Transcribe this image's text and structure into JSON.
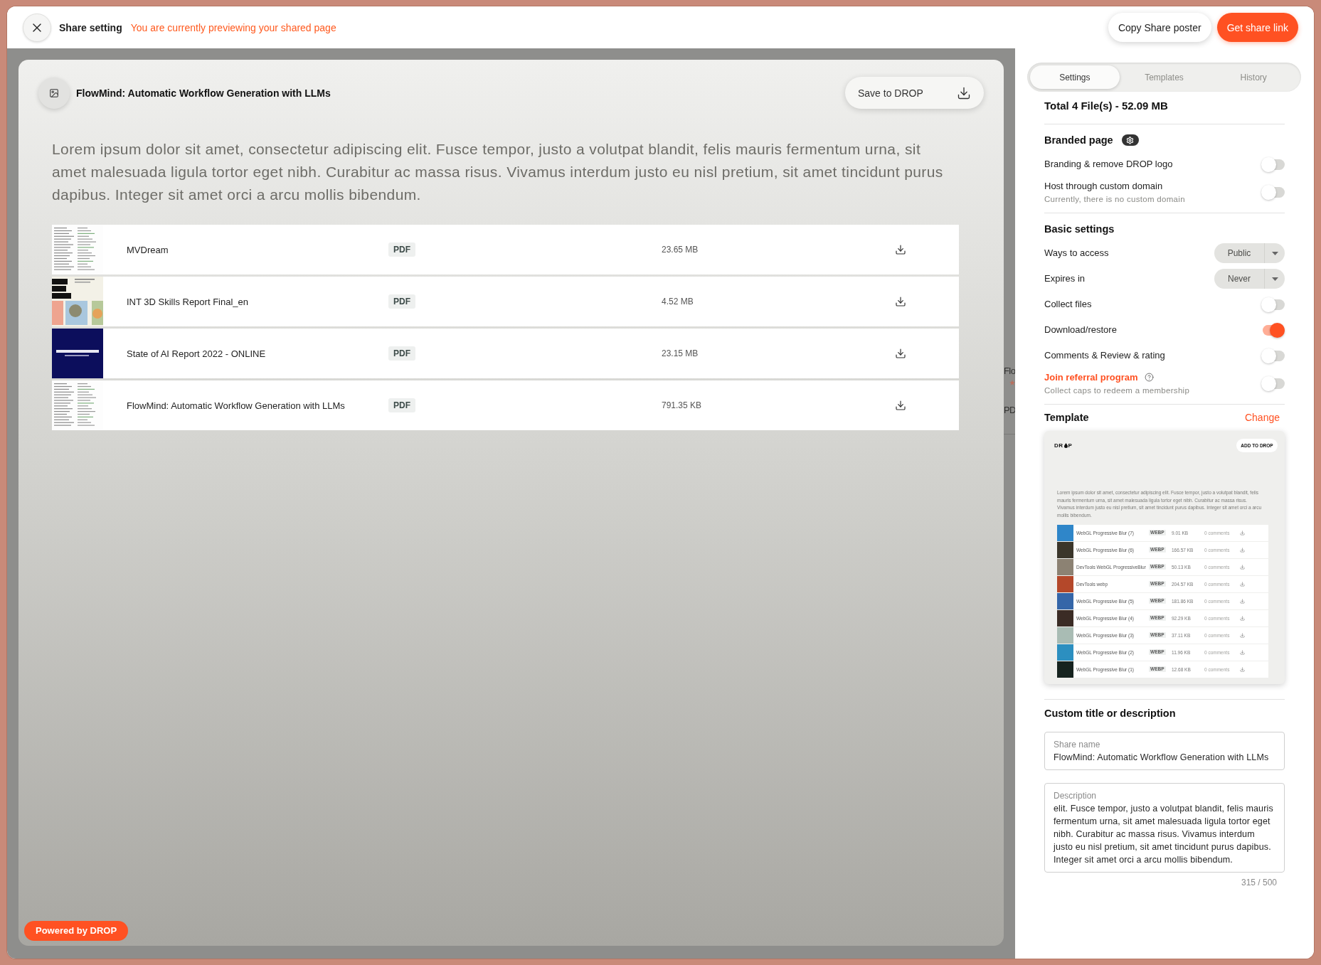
{
  "topbar": {
    "title": "Share setting",
    "notice": "You are currently previewing your shared page",
    "buttons": [
      {
        "label": "Copy Share poster",
        "kind": "secondary"
      },
      {
        "label": "Get share link",
        "kind": "primary"
      }
    ]
  },
  "preview": {
    "title": "FlowMind: Automatic Workflow Generation with LLMs",
    "save_button": "Save to DROP",
    "description": "Lorem ipsum dolor sit amet, consectetur adipiscing elit. Fusce tempor, justo a volutpat blandit, felis mauris fermentum urna, sit amet malesuada ligula tortor eget nibh. Curabitur ac massa risus. Vivamus interdum justo eu nisl pretium, sit amet tincidunt purus dapibus. Integer sit amet orci a arcu mollis bibendum.",
    "files": [
      {
        "name": "MVDream",
        "type": "PDF",
        "size": "23.65 MB",
        "thumbnail": {
          "kind": "text-page"
        }
      },
      {
        "name": "INT 3D Skills Report Final_en",
        "type": "PDF",
        "size": "4.52 MB",
        "thumbnail": {
          "kind": "light-cover"
        }
      },
      {
        "name": "State of AI Report 2022 - ONLINE",
        "type": "PDF",
        "size": "23.15 MB",
        "thumbnail": {
          "kind": "dark-cover"
        }
      },
      {
        "name": "FlowMind: Automatic Workflow Generation with LLMs",
        "type": "PDF",
        "size": "791.35 KB",
        "thumbnail": {
          "kind": "text-page"
        }
      }
    ],
    "powered_by": "Powered by DROP"
  },
  "background_fragments": [
    "Flo",
    "PD"
  ],
  "panel": {
    "tabs": [
      {
        "label": "Settings",
        "selected": true
      },
      {
        "label": "Templates",
        "selected": false
      },
      {
        "label": "History",
        "selected": false
      }
    ],
    "total": "Total 4 File(s) - 52.09 MB",
    "sections": [
      {
        "kind": "branded",
        "title": "Branded page",
        "items": [
          {
            "kind": "toggle",
            "label": "Branding & remove DROP logo",
            "on": false
          },
          {
            "kind": "toggle",
            "label": "Host through custom domain",
            "note": "Currently, there is no custom domain",
            "on": false
          }
        ]
      },
      {
        "kind": "plain",
        "title": "Basic settings",
        "items": [
          {
            "kind": "select",
            "label": "Ways to access",
            "value": "Public"
          },
          {
            "kind": "select",
            "label": "Expires in",
            "value": "Never"
          },
          {
            "kind": "toggle",
            "label": "Collect files",
            "on": false
          },
          {
            "kind": "toggle",
            "label": "Download/restore",
            "on": true
          },
          {
            "kind": "toggle",
            "label": "Comments & Review & rating",
            "on": false
          },
          {
            "kind": "referral",
            "label": "Join referral program",
            "note": "Collect caps to redeem a membership",
            "on": false
          }
        ]
      }
    ],
    "template": {
      "title": "Template",
      "action": "Change",
      "preview": {
        "logo": [
          "DR",
          "P"
        ],
        "button": "ADD TO DROP",
        "description": "Lorem ipsum dolor sit amet, consectetur adipiscing elit. Fusce tempor, justo a volutpat blandit, felis mauris fermentum urna, sit amet malesuada ligula tortor eget nibh. Curabitur ac massa risus. Vivamus interdum justo eu nisl pretium, sit amet tincidunt purus dapibus. Integer sit amet orci a arcu mollis bibendum.",
        "files": [
          {
            "name": "WebGL Progressive Blur (7)",
            "type": "WEBP",
            "size": "9.01 KB",
            "comments": "0 comments"
          },
          {
            "name": "WebGL Progressive Blur (6)",
            "type": "WEBP",
            "size": "166.57 KB",
            "comments": "0 comments"
          },
          {
            "name": "DevTools WebGL ProgressiveBlur",
            "type": "WEBP",
            "size": "50.13 KB",
            "comments": "0 comments"
          },
          {
            "name": "DevTools webp",
            "type": "WEBP",
            "size": "204.57 KB",
            "comments": "0 comments"
          },
          {
            "name": "WebGL Progressive Blur (5)",
            "type": "WEBP",
            "size": "181.86 KB",
            "comments": "0 comments"
          },
          {
            "name": "WebGL Progressive Blur (4)",
            "type": "WEBP",
            "size": "92.29 KB",
            "comments": "0 comments"
          },
          {
            "name": "WebGL Progressive Blur (3)",
            "type": "WEBP",
            "size": "37.11 KB",
            "comments": "0 comments"
          },
          {
            "name": "WebGL Progressive Blur (2)",
            "type": "WEBP",
            "size": "11.96 KB",
            "comments": "0 comments"
          },
          {
            "name": "WebGL Progressive Blur (1)",
            "type": "WEBP",
            "size": "12.68 KB",
            "comments": "0 comments"
          }
        ]
      }
    },
    "custom": {
      "title": "Custom title or description",
      "name_field": {
        "label": "Share name",
        "value": "FlowMind: Automatic Workflow Generation with LLMs"
      },
      "description_field": {
        "label": "Description",
        "value": "elit. Fusce tempor, justo a volutpat blandit, felis mauris fermentum urna, sit amet malesuada ligula tortor eget nibh. Curabitur ac massa risus. Vivamus interdum justo eu nisl pretium, sit amet tincidunt purus dapibus. Integer sit amet orci a arcu mollis bibendum."
      },
      "counter": "315 / 500"
    }
  }
}
